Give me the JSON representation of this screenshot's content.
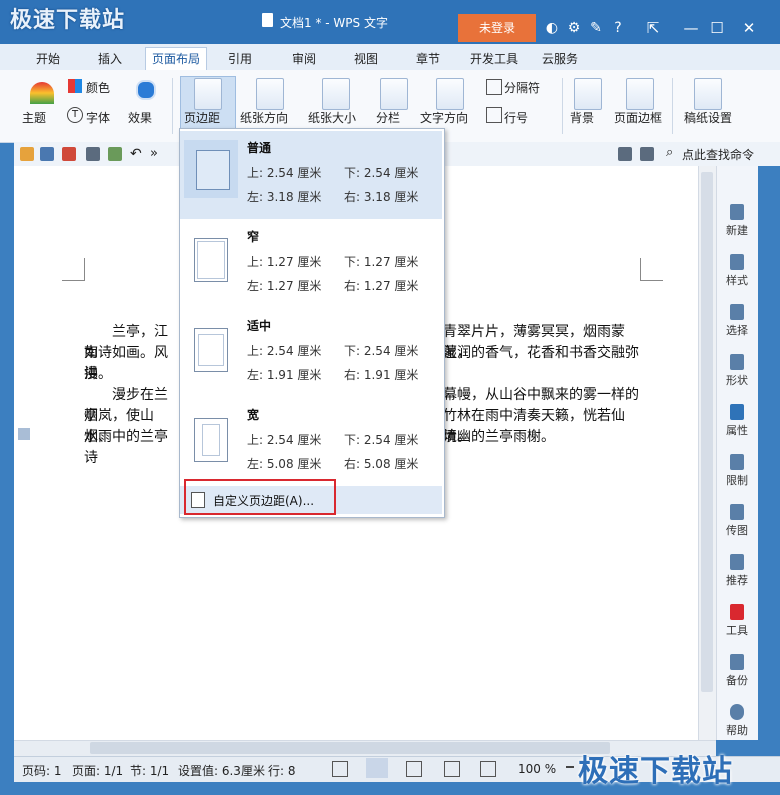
{
  "titlebar": {
    "logo_text": "极速下载站",
    "app_label": "WPS 文字",
    "doc_title": "文档1 * - WPS 文字",
    "login_button": "未登录",
    "icons": [
      "skin-icon",
      "gear-icon",
      "feedback-icon",
      "help-icon"
    ],
    "help_glyph": "?",
    "window_controls": [
      "restore-icon",
      "minimize-icon",
      "maximize-icon",
      "close-icon"
    ]
  },
  "tabs": [
    "开始",
    "插入",
    "页面布局",
    "引用",
    "审阅",
    "视图",
    "章节",
    "开发工具",
    "云服务"
  ],
  "active_tab": "页面布局",
  "ribbon": {
    "theme": "主题",
    "color": "颜色",
    "font": "字体",
    "effect": "效果",
    "margins": "页边距",
    "orientation": "纸张方向",
    "size": "纸张大小",
    "columns": "分栏",
    "text_direction": "文字方向",
    "separator": "分隔符",
    "line_number": "行号",
    "background": "背景",
    "page_border": "页面边框",
    "manuscript": "稿纸设置"
  },
  "quick_access": {
    "search_label": "点此查找命令"
  },
  "margins_menu": {
    "options": [
      {
        "name": "普通",
        "top": "上: 2.54 厘米",
        "bottom": "下: 2.54 厘米",
        "left": "左: 3.18 厘米",
        "right": "右: 3.18 厘米"
      },
      {
        "name": "窄",
        "top": "上: 1.27 厘米",
        "bottom": "下: 1.27 厘米",
        "left": "左: 1.27 厘米",
        "right": "右: 1.27 厘米"
      },
      {
        "name": "适中",
        "top": "上: 2.54 厘米",
        "bottom": "下: 2.54 厘米",
        "left": "左: 1.91 厘米",
        "right": "右: 1.91 厘米"
      },
      {
        "name": "宽",
        "top": "上: 2.54 厘米",
        "bottom": "下: 2.54 厘米",
        "left": "左: 5.08 厘米",
        "right": "右: 5.08 厘米"
      }
    ],
    "custom": "自定义页边距(A)..."
  },
  "document": {
    "lines": [
      {
        "left": "兰亭，江南",
        "right": "青翠片片，薄雾冥冥，烟雨蒙蒙，"
      },
      {
        "left": "如诗如画。风拂",
        "right": "湿润的香气，花香和书香交融弥"
      },
      {
        "left": "漫。",
        "right": ""
      },
      {
        "left": "漫步在兰亭",
        "right": "幕幔，从山谷中飘来的雾一样的"
      },
      {
        "left": "烟岚，使山水、",
        "right": "竹林在雨中清奏天籁，恍若仙境。"
      },
      {
        "left": "烟雨中的兰亭诗",
        "right": "清幽的兰亭雨榭。"
      }
    ]
  },
  "right_panel": [
    "新建",
    "样式",
    "选择",
    "形状",
    "属性",
    "限制",
    "传图",
    "推荐",
    "工具",
    "备份",
    "帮助"
  ],
  "status": {
    "page_num": "页码: 1",
    "pages": "页面: 1/1",
    "section": "节: 1/1",
    "setting": "设置值: 6.3厘米",
    "row": "行: 8",
    "zoom": "100 %",
    "watermark": "极速下载站"
  },
  "colors": {
    "accent": "#2f73b8",
    "login": "#e8723a",
    "highlight": "#d9282f",
    "selected": "#dbe7f5"
  }
}
